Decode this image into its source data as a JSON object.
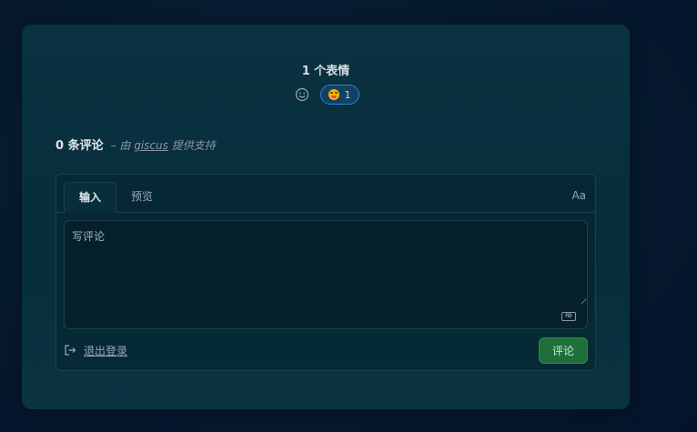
{
  "reactions": {
    "title": "1 个表情",
    "add_icon": "smiley-icon",
    "items": [
      {
        "emoji": "grinning-face",
        "count": "1",
        "color": "#f4b400"
      }
    ]
  },
  "comments": {
    "count_label": "0 条评论",
    "powered_prefix": "– 由",
    "powered_link": "giscus",
    "powered_suffix": "提供支持"
  },
  "editor": {
    "tabs": [
      {
        "label": "输入",
        "active": true
      },
      {
        "label": "预览",
        "active": false
      }
    ],
    "font_toggle": "Aa",
    "placeholder": "写评论",
    "markdown_badge": "MD",
    "signout_label": "退出登录",
    "submit_label": "评论"
  },
  "colors": {
    "accent_blue": "#2f7fe0",
    "submit_green": "#1f6f3a"
  }
}
